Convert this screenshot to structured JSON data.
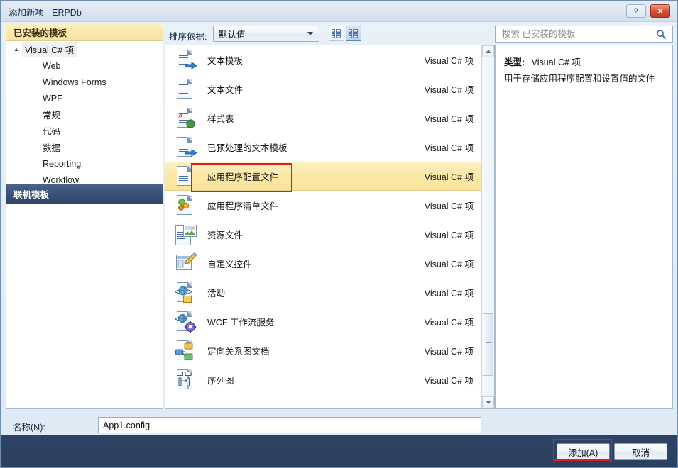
{
  "window": {
    "title": "添加新项 - ERPDb",
    "help_label": "?",
    "close_label": "✕"
  },
  "sidebar": {
    "installed_header": "已安装的模板",
    "online_header": "联机模板",
    "tree_root": "Visual C# 项",
    "tree_children": [
      "Web",
      "Windows Forms",
      "WPF",
      "常规",
      "代码",
      "数据",
      "Reporting",
      "Workflow"
    ]
  },
  "toolbar": {
    "sort_label": "排序依据:",
    "sort_value": "默认值",
    "view_small_name": "小图标视图",
    "view_medium_name": "中等图标视图"
  },
  "search": {
    "placeholder": "搜索 已安装的模板",
    "value": ""
  },
  "templates": [
    {
      "name": "文本模板",
      "kind": "Visual C# 项",
      "icon": "text-template-icon",
      "selected": false
    },
    {
      "name": "文本文件",
      "kind": "Visual C# 项",
      "icon": "text-file-icon",
      "selected": false
    },
    {
      "name": "样式表",
      "kind": "Visual C# 项",
      "icon": "stylesheet-icon",
      "selected": false
    },
    {
      "name": "已预处理的文本模板",
      "kind": "Visual C# 项",
      "icon": "preprocessed-template-icon",
      "selected": false
    },
    {
      "name": "应用程序配置文件",
      "kind": "Visual C# 项",
      "icon": "app-config-icon",
      "selected": true
    },
    {
      "name": "应用程序清单文件",
      "kind": "Visual C# 项",
      "icon": "app-manifest-icon",
      "selected": false
    },
    {
      "name": "资源文件",
      "kind": "Visual C# 项",
      "icon": "resource-file-icon",
      "selected": false
    },
    {
      "name": "自定义控件",
      "kind": "Visual C# 项",
      "icon": "custom-control-icon",
      "selected": false
    },
    {
      "name": "活动",
      "kind": "Visual C# 项",
      "icon": "activity-icon",
      "selected": false
    },
    {
      "name": "WCF 工作流服务",
      "kind": "Visual C# 项",
      "icon": "wcf-workflow-service-icon",
      "selected": false
    },
    {
      "name": "定向关系图文档",
      "kind": "Visual C# 项",
      "icon": "directed-graph-icon",
      "selected": false
    },
    {
      "name": "序列图",
      "kind": "Visual C# 项",
      "icon": "sequence-diagram-icon",
      "selected": false
    }
  ],
  "details": {
    "kind_label": "类型:",
    "kind_value": "Visual C# 项",
    "description": "用于存储应用程序配置和设置值的文件"
  },
  "name_row": {
    "label": "名称(N):",
    "value": "App1.config"
  },
  "footer": {
    "add_label": "添加(A)",
    "cancel_label": "取消"
  },
  "colors": {
    "selection_amber": "#fbe8a6",
    "installed_header": "#fbe9ad",
    "online_header": "#3c5379",
    "footer": "#2f4465",
    "annotation_red": "#e01b24",
    "close_red": "#d4503a"
  }
}
